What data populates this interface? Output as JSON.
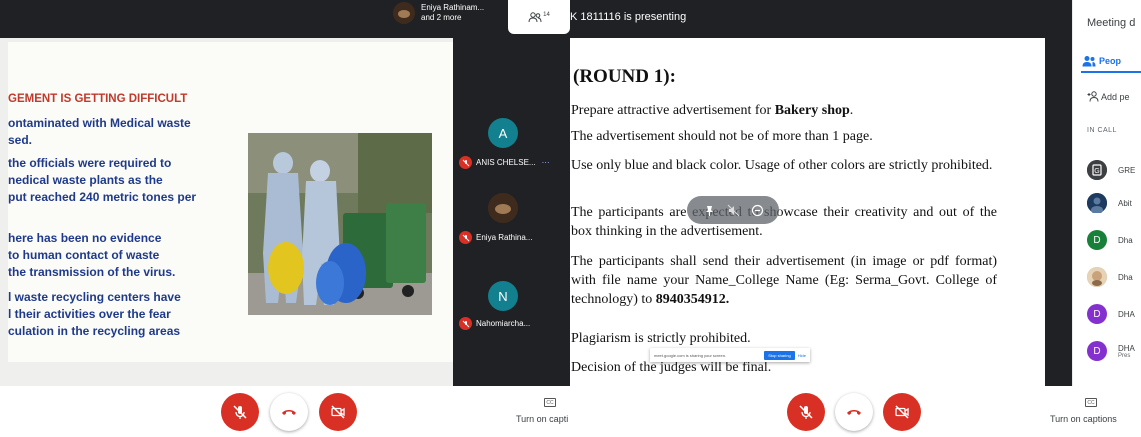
{
  "left": {
    "top_user": {
      "name": "Eniya Rathinam...",
      "more": "and 2 more"
    },
    "people_count": "14",
    "slide": {
      "title": "GEMENT IS GETTING DIFFICULT",
      "lines": [
        "ontaminated with Medical waste",
        "sed.",
        " the officials were required to",
        "nedical waste plants as the",
        "put reached 240 metric tones per",
        "here has been no evidence",
        " to human contact of waste",
        " the transmission of the virus.",
        "l waste recycling centers  have",
        "l their activities over the fear",
        "culation in the recycling areas"
      ]
    },
    "participants": [
      {
        "initial": "A",
        "name": "ANIS CHELSE...",
        "color": "#12808f"
      },
      {
        "initial": "",
        "name": "Eniya Rathina...",
        "color": "#3e2b1e"
      },
      {
        "initial": "N",
        "name": "Nahomiarcha...",
        "color": "#12808f"
      }
    ],
    "captions_label": "Turn on capti"
  },
  "right": {
    "presenting_text": "K 1811116 is presenting",
    "doc": {
      "heading": "(ROUND 1):",
      "p1_pre": "Prepare attractive advertisement for ",
      "p1_bold": "Bakery shop",
      "p1_post": ".",
      "p2": "The advertisement should not be of more than 1 page.",
      "p3": "Use only blue and black color. Usage of other colors are strictly prohibited.",
      "p4": "The participants are expected to showcase their creativity and out of the box thinking in the advertisement.",
      "p5_pre": "The participants shall send their advertisement (in image or pdf format) with file name your Name_College Name (Eg: Serma_Govt. College of technology) to ",
      "p5_bold": "8940354912.",
      "p6": "Plagiarism is strictly prohibited.",
      "p7": "Decision of the judges will be final."
    },
    "share_banner": {
      "text": "meet.google.com is sharing your screen.",
      "stop": "Stop sharing",
      "hide": "Hide"
    },
    "captions_label": "Turn on captions",
    "panel": {
      "title": "Meeting d",
      "people_tab": "Peop",
      "add_people": "Add pe",
      "in_call": "IN CALL",
      "people": [
        {
          "initial": "G",
          "name": "GRE",
          "sub": "",
          "color": "#3c4043"
        },
        {
          "initial": "",
          "name": "Abit",
          "sub": "",
          "color": "#1f3a5f"
        },
        {
          "initial": "D",
          "name": "Dha",
          "sub": "",
          "color": "#188038"
        },
        {
          "initial": "",
          "name": "Dha",
          "sub": "",
          "color": "#c9a27a"
        },
        {
          "initial": "D",
          "name": "DHA",
          "sub": "",
          "color": "#8430ce"
        },
        {
          "initial": "D",
          "name": "DHA",
          "sub": "Pres",
          "color": "#8430ce"
        }
      ]
    }
  }
}
